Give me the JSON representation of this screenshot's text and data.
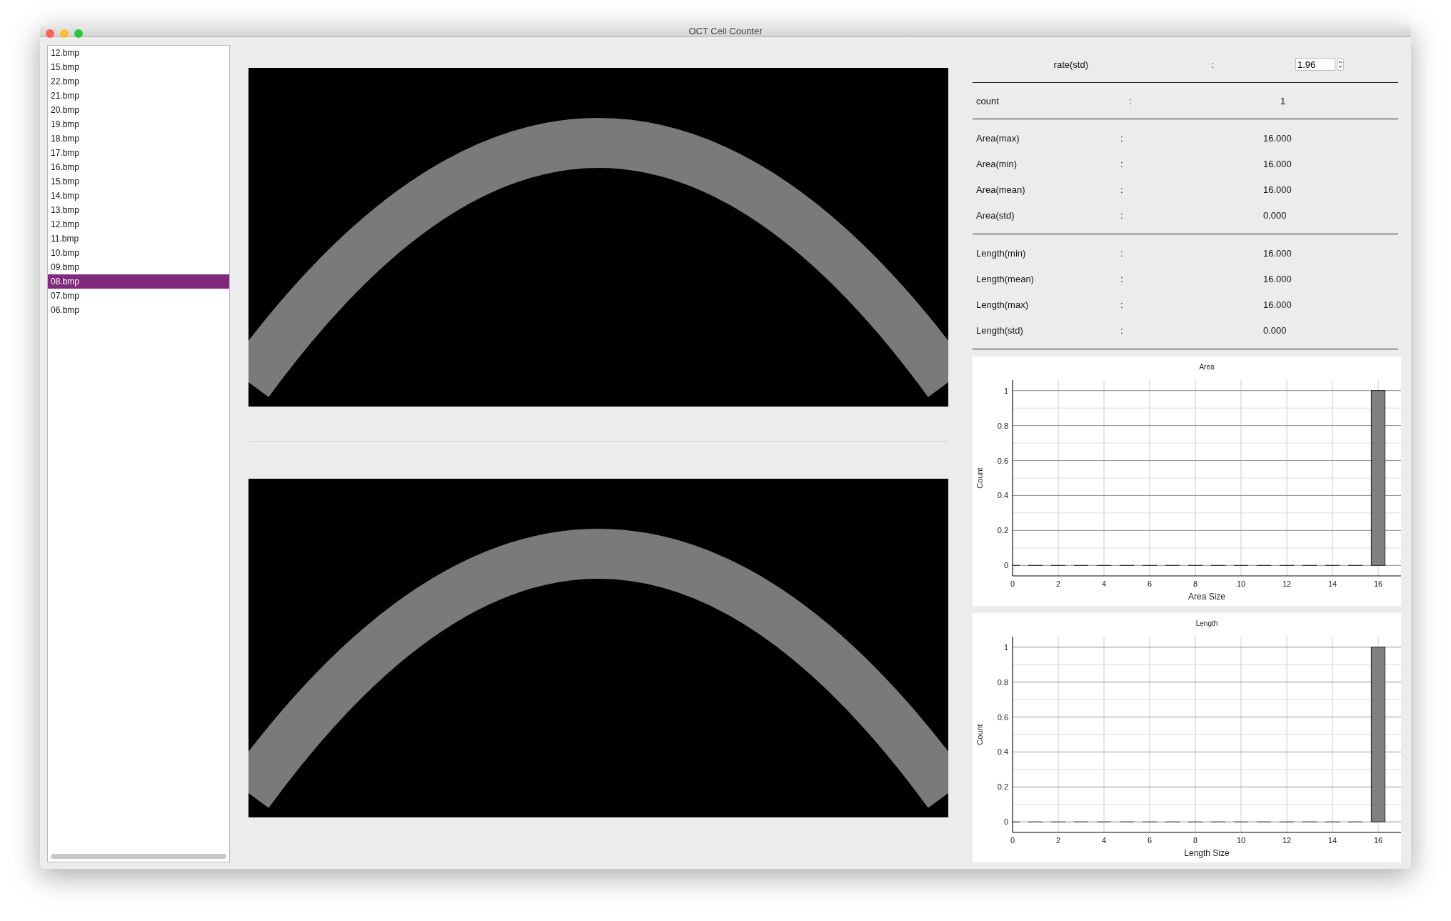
{
  "window": {
    "title": "OCT Cell Counter"
  },
  "files": [
    {
      "label": "12.bmp",
      "selected": false
    },
    {
      "label": "15.bmp",
      "selected": false
    },
    {
      "label": "22.bmp",
      "selected": false
    },
    {
      "label": "21.bmp",
      "selected": false
    },
    {
      "label": "20.bmp",
      "selected": false
    },
    {
      "label": "19.bmp",
      "selected": false
    },
    {
      "label": "18.bmp",
      "selected": false
    },
    {
      "label": "17.bmp",
      "selected": false
    },
    {
      "label": "16.bmp",
      "selected": false
    },
    {
      "label": "15.bmp",
      "selected": false
    },
    {
      "label": "14.bmp",
      "selected": false
    },
    {
      "label": "13.bmp",
      "selected": false
    },
    {
      "label": "12.bmp",
      "selected": false
    },
    {
      "label": "11.bmp",
      "selected": false
    },
    {
      "label": "10.bmp",
      "selected": false
    },
    {
      "label": "09.bmp",
      "selected": false
    },
    {
      "label": "08.bmp",
      "selected": true
    },
    {
      "label": "07.bmp",
      "selected": false
    },
    {
      "label": "06.bmp",
      "selected": false
    }
  ],
  "rate": {
    "label": "rate(std)",
    "separator": ":",
    "value": "1.96"
  },
  "count": {
    "label": "count",
    "separator": ":",
    "value": "1"
  },
  "stat_groups": [
    [
      {
        "label": "Area(max)",
        "separator": ":",
        "value": "16.000"
      },
      {
        "label": "Area(min)",
        "separator": ":",
        "value": "16.000"
      },
      {
        "label": "Area(mean)",
        "separator": ":",
        "value": "16.000"
      },
      {
        "label": "Area(std)",
        "separator": ":",
        "value": "0.000"
      }
    ],
    [
      {
        "label": "Length(min)",
        "separator": ":",
        "value": "16.000"
      },
      {
        "label": "Length(mean)",
        "separator": ":",
        "value": "16.000"
      },
      {
        "label": "Length(max)",
        "separator": ":",
        "value": "16.000"
      },
      {
        "label": "Length(std)",
        "separator": ":",
        "value": "0.000"
      }
    ]
  ],
  "charts": [
    {
      "chart_data": {
        "type": "bar",
        "title": "Area",
        "xlabel": "Area Size",
        "ylabel": "Count",
        "x": [
          0,
          1,
          2,
          3,
          4,
          5,
          6,
          7,
          8,
          9,
          10,
          11,
          12,
          13,
          14,
          15,
          16
        ],
        "values": [
          0,
          0,
          0,
          0,
          0,
          0,
          0,
          0,
          0,
          0,
          0,
          0,
          0,
          0,
          0,
          0,
          1
        ],
        "xlim": [
          0,
          17
        ],
        "ylim": [
          -0.06,
          1.06
        ],
        "xticks": [
          0,
          2,
          4,
          6,
          8,
          10,
          12,
          14,
          16
        ],
        "yticks": [
          0,
          0.2,
          0.4,
          0.6,
          0.8,
          1
        ],
        "grid": true
      }
    },
    {
      "chart_data": {
        "type": "bar",
        "title": "Length",
        "xlabel": "Length Size",
        "ylabel": "Count",
        "x": [
          0,
          1,
          2,
          3,
          4,
          5,
          6,
          7,
          8,
          9,
          10,
          11,
          12,
          13,
          14,
          15,
          16
        ],
        "values": [
          0,
          0,
          0,
          0,
          0,
          0,
          0,
          0,
          0,
          0,
          0,
          0,
          0,
          0,
          0,
          0,
          1
        ],
        "xlim": [
          0,
          17
        ],
        "ylim": [
          -0.06,
          1.06
        ],
        "xticks": [
          0,
          2,
          4,
          6,
          8,
          10,
          12,
          14,
          16
        ],
        "yticks": [
          0,
          0.2,
          0.4,
          0.6,
          0.8,
          1
        ],
        "grid": true
      }
    }
  ]
}
